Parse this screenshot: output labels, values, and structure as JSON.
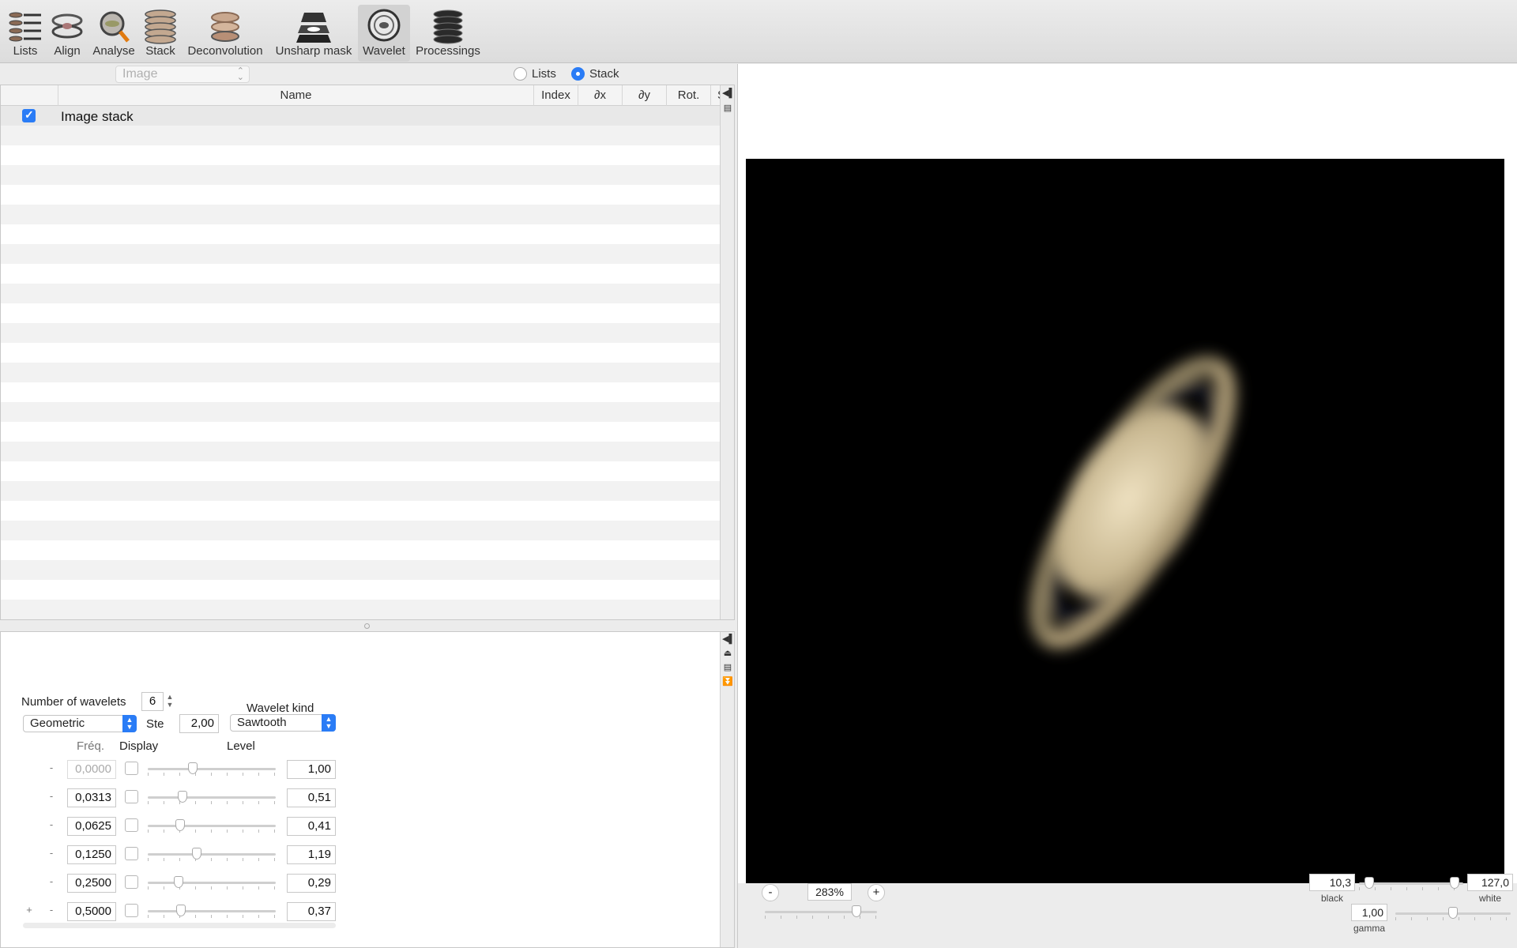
{
  "toolbar": {
    "items": [
      {
        "label": "Lists",
        "icon": "lists-icon"
      },
      {
        "label": "Align",
        "icon": "align-icon"
      },
      {
        "label": "Analyse",
        "icon": "analyse-icon"
      },
      {
        "label": "Stack",
        "icon": "stack-icon"
      },
      {
        "label": "Deconvolution",
        "icon": "deconvolution-icon"
      },
      {
        "label": "Unsharp mask",
        "icon": "unsharp-mask-icon"
      },
      {
        "label": "Wavelet",
        "icon": "wavelet-icon"
      },
      {
        "label": "Processings",
        "icon": "processings-icon"
      }
    ],
    "active": "Wavelet"
  },
  "source": {
    "popup_value": "Image",
    "radio_lists": "Lists",
    "radio_stack": "Stack",
    "selected": "Stack"
  },
  "table": {
    "columns": [
      "Name",
      "Index",
      "∂x",
      "∂y",
      "Rot.",
      "S"
    ],
    "rows": [
      {
        "checked": true,
        "name": "Image stack"
      }
    ]
  },
  "wavelet": {
    "number_label": "Number of wavelets",
    "number_value": "6",
    "kind_label": "Wavelet kind",
    "progression": "Geometric",
    "step_label": "Ste",
    "step_value": "2,00",
    "kind_value": "Sawtooth",
    "col_freq": "Fréq.",
    "col_display": "Display",
    "col_level": "Level",
    "plus_label": "+",
    "minus_label": "-",
    "rows": [
      {
        "freq": "0,0000",
        "level": "1,00",
        "slider": 0.35,
        "disabled": true
      },
      {
        "freq": "0,0313",
        "level": "0,51",
        "slider": 0.27
      },
      {
        "freq": "0,0625",
        "level": "0,41",
        "slider": 0.25
      },
      {
        "freq": "0,1250",
        "level": "1,19",
        "slider": 0.38
      },
      {
        "freq": "0,2500",
        "level": "0,29",
        "slider": 0.24
      },
      {
        "freq": "0,5000",
        "level": "0,37",
        "slider": 0.26
      }
    ]
  },
  "viewer": {
    "zoom_minus": "-",
    "zoom_value": "283%",
    "zoom_plus": "+",
    "zoom_slider": 0.82,
    "black_value": "10,3",
    "black_label": "black",
    "white_value": "127,0",
    "white_label": "white",
    "gamma_value": "1,00",
    "gamma_label": "gamma",
    "black_slider": 0.1,
    "white_slider": 0.92,
    "gamma_slider": 0.5
  }
}
